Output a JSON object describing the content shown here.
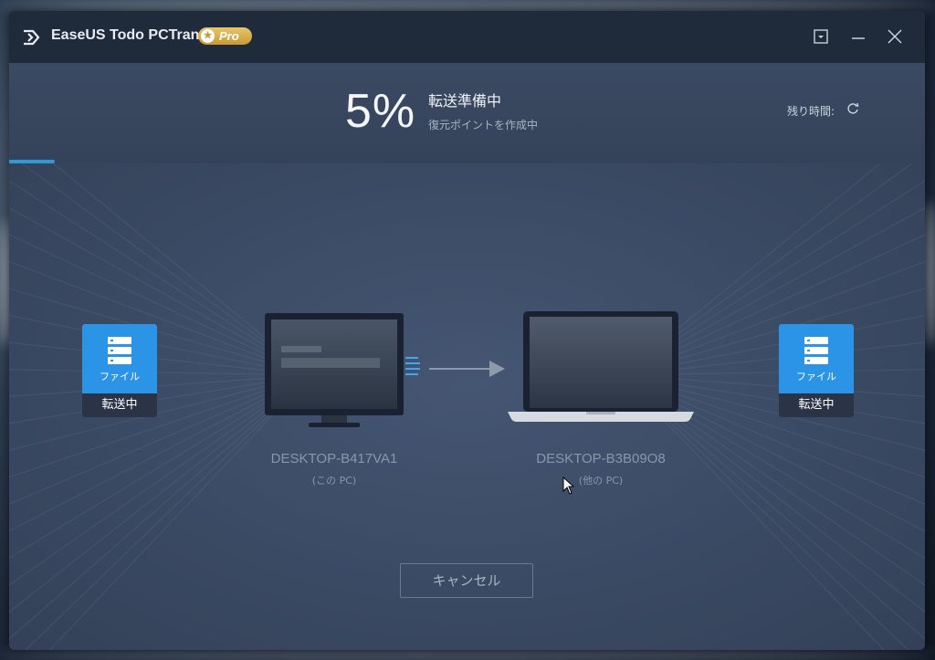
{
  "app": {
    "title": "EaseUS Todo PCTrans",
    "badge": "Pro"
  },
  "window_controls": [
    "dropdown-icon",
    "minimize-icon",
    "close-icon"
  ],
  "progress": {
    "percent_text": "5%",
    "value": 0.05,
    "status_title": "転送準備中",
    "status_sub": "復元ポイントを作成中",
    "remaining_label": "残り時間:"
  },
  "source": {
    "file_label": "ファイル",
    "state": "転送中",
    "pc_name": "DESKTOP-B417VA1",
    "pc_sub": "(この PC)"
  },
  "target": {
    "file_label": "ファイル",
    "state": "転送中",
    "pc_name": "DESKTOP-B3B09O8",
    "pc_sub": "(他の PC)"
  },
  "buttons": {
    "cancel": "キャンセル"
  },
  "colors": {
    "accent": "#2d9ad8",
    "file_card": "#2c94e6",
    "badge": "#d4a84a"
  }
}
